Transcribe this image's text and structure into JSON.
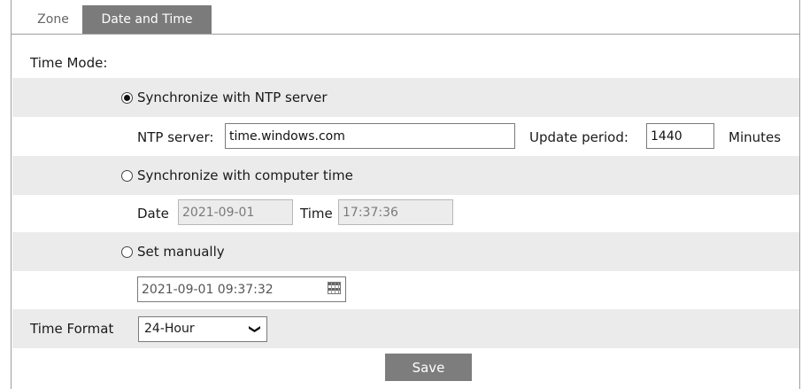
{
  "tabs": [
    {
      "label": "Zone",
      "active": false
    },
    {
      "label": "Date and Time",
      "active": true
    }
  ],
  "time_mode": {
    "label": "Time Mode:",
    "options": {
      "ntp": {
        "label": "Synchronize with NTP server",
        "selected": true
      },
      "computer": {
        "label": "Synchronize with computer time",
        "selected": false
      },
      "manual": {
        "label": "Set manually",
        "selected": false
      }
    }
  },
  "ntp": {
    "server_label": "NTP server:",
    "server_value": "time.windows.com",
    "update_label": "Update period:",
    "update_value": "1440",
    "unit": "Minutes"
  },
  "computer_time": {
    "date_label": "Date",
    "date_value": "2021-09-01",
    "time_label": "Time",
    "time_value": "17:37:36"
  },
  "manual": {
    "datetime_value": "2021-09-01 09:37:32",
    "icon": "calendar-icon"
  },
  "time_format": {
    "label": "Time Format",
    "selected": "24-Hour"
  },
  "save_label": "Save",
  "colors": {
    "accent": "#7b7b7b",
    "row_bg": "#ebebeb"
  }
}
